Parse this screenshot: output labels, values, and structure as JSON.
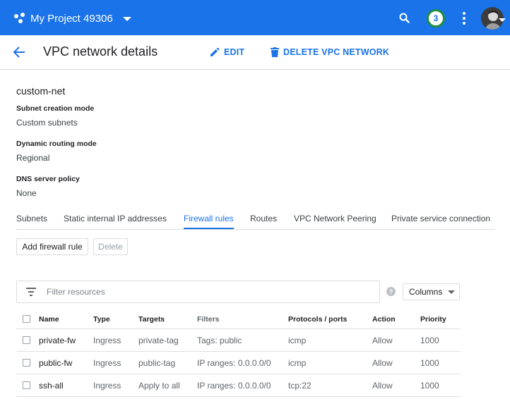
{
  "appbar": {
    "project_name": "My Project 49306",
    "notification_count": "3",
    "bg_color": "#1a73e8",
    "icons": [
      "project-icon",
      "search-icon",
      "more-vert-icon",
      "avatar"
    ]
  },
  "header": {
    "title": "VPC network details",
    "edit_label": "EDIT",
    "delete_label": "DELETE VPC NETWORK"
  },
  "details": {
    "network_name": "custom-net",
    "fields": [
      {
        "label": "Subnet creation mode",
        "value": "Custom subnets"
      },
      {
        "label": "Dynamic routing mode",
        "value": "Regional"
      },
      {
        "label": "DNS server policy",
        "value": "None"
      }
    ]
  },
  "tabs": [
    {
      "label": "Subnets"
    },
    {
      "label": "Static internal IP addresses"
    },
    {
      "label": "Firewall rules",
      "active": true
    },
    {
      "label": "Routes"
    },
    {
      "label": "VPC Network Peering"
    },
    {
      "label": "Private service connection"
    }
  ],
  "actions": {
    "add_label": "Add firewall rule",
    "delete_label": "Delete"
  },
  "filter": {
    "placeholder": "Filter resources",
    "columns_label": "Columns",
    "help_glyph": "?"
  },
  "table": {
    "columns": [
      "Name",
      "Type",
      "Targets",
      "Filters",
      "Protocols / ports",
      "Action",
      "Priority"
    ],
    "rows": [
      [
        "private-fw",
        "Ingress",
        "private-tag",
        "Tags: public",
        "icmp",
        "Allow",
        "1000"
      ],
      [
        "public-fw",
        "Ingress",
        "public-tag",
        "IP ranges: 0.0.0.0/0",
        "icmp",
        "Allow",
        "1000"
      ],
      [
        "ssh-all",
        "Ingress",
        "Apply to all",
        "IP ranges: 0.0.0.0/0",
        "tcp:22",
        "Allow",
        "1000"
      ]
    ]
  }
}
